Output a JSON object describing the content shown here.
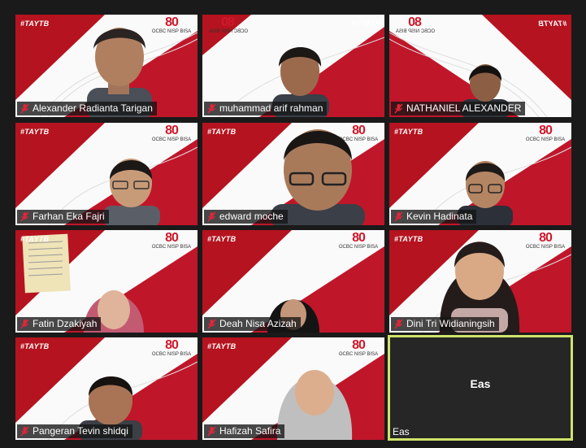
{
  "meeting": {
    "brand_hashtag": "#TAYTB",
    "brand_logo_number": "80",
    "brand_logo_text": "OCBC NISP BISA",
    "participants": [
      {
        "name": "Alexander Radianta Tarigan",
        "muted": true
      },
      {
        "name": "muhammad arif rahman",
        "muted": true
      },
      {
        "name": "NATHANIEL ALEXANDER",
        "muted": true
      },
      {
        "name": "Farhan Eka Fajri",
        "muted": true
      },
      {
        "name": "edward moche",
        "muted": true
      },
      {
        "name": "Kevin Hadinata",
        "muted": true
      },
      {
        "name": "Fatin Dzakiyah",
        "muted": true
      },
      {
        "name": "Deah Nisa Azizah",
        "muted": true
      },
      {
        "name": "Dini Tri Widianingsih",
        "muted": true
      },
      {
        "name": "Pangeran Tevin shidqi",
        "muted": true
      },
      {
        "name": "Hafizah Safira",
        "muted": true
      },
      {
        "name": "Eas",
        "muted": false,
        "video_off": true,
        "center_label": "Eas",
        "active_speaker": true
      }
    ]
  },
  "colors": {
    "brand_red": "#c0162a",
    "active_border": "#cfe36a",
    "muted_icon": "#e0263a"
  }
}
